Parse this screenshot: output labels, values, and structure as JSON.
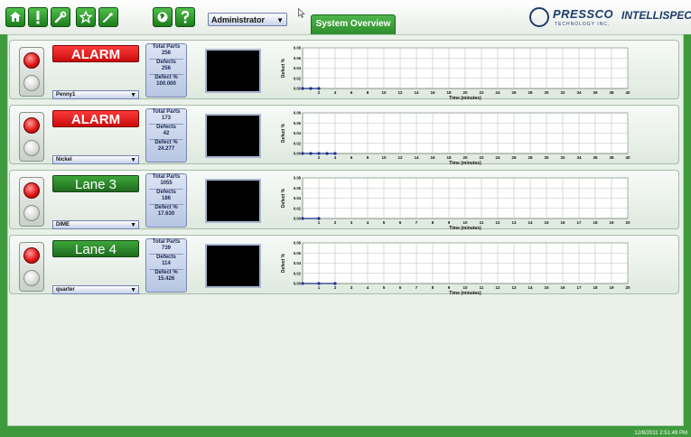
{
  "toolbar": {
    "user_select": "Administrator",
    "active_tab": "System Overview",
    "logo_pressco": "PRESSCO",
    "logo_pressco_sub": "TECHNOLOGY INC.",
    "logo_intellispec": "INTELLISPEC",
    "home_icon": "home-icon",
    "alert_icon": "exclamation-icon",
    "tools_icon": "wrench-icon",
    "favorites_icon": "star-icon",
    "wand_icon": "wand-icon",
    "globe_icon": "globe-icon",
    "help_icon": "question-icon"
  },
  "footer": {
    "datetime": "12/8/2011 2:51:49 PM"
  },
  "lanes": [
    {
      "status": "ALARM",
      "status_kind": "alarm",
      "product": "Penny1",
      "total_parts_label": "Total Parts",
      "total_parts": "256",
      "defects_label": "Defects",
      "defects": "256",
      "defect_pct_label": "Defect %",
      "defect_pct": "100.000"
    },
    {
      "status": "ALARM",
      "status_kind": "alarm",
      "product": "Nickel",
      "total_parts_label": "Total Parts",
      "total_parts": "173",
      "defects_label": "Defects",
      "defects": "42",
      "defect_pct_label": "Defect %",
      "defect_pct": "24.277"
    },
    {
      "status": "Lane 3",
      "status_kind": "ok",
      "product": "DIME",
      "total_parts_label": "Total Parts",
      "total_parts": "1055",
      "defects_label": "Defects",
      "defects": "186",
      "defect_pct_label": "Defect %",
      "defect_pct": "17.630"
    },
    {
      "status": "Lane 4",
      "status_kind": "ok",
      "product": "quarter",
      "total_parts_label": "Total Parts",
      "total_parts": "739",
      "defects_label": "Defects",
      "defects": "114",
      "defect_pct_label": "Defect %",
      "defect_pct": "15.426"
    }
  ],
  "chart_data": [
    {
      "type": "line",
      "xlabel": "Time (minutes)",
      "ylabel": "Defect %",
      "xlim": [
        0,
        40
      ],
      "ylim": [
        0,
        0.08
      ],
      "x_ticks": [
        "2",
        "4",
        "6",
        "8",
        "10",
        "12",
        "14",
        "16",
        "18",
        "20",
        "22",
        "24",
        "26",
        "28",
        "30",
        "32",
        "34",
        "36",
        "38",
        "40"
      ],
      "y_ticks": [
        "0.00",
        "0.02",
        "0.04",
        "0.06",
        "0.08"
      ],
      "grid": true,
      "series": [
        {
          "x": [
            0,
            1,
            2
          ],
          "y": [
            0,
            0,
            0
          ]
        }
      ]
    },
    {
      "type": "line",
      "xlabel": "Time (minutes)",
      "ylabel": "Defect %",
      "xlim": [
        0,
        40
      ],
      "ylim": [
        0,
        0.08
      ],
      "x_ticks": [
        "2",
        "4",
        "6",
        "8",
        "10",
        "12",
        "14",
        "16",
        "18",
        "20",
        "22",
        "24",
        "26",
        "28",
        "30",
        "32",
        "34",
        "36",
        "38",
        "40"
      ],
      "y_ticks": [
        "0.00",
        "0.02",
        "0.04",
        "0.06",
        "0.08"
      ],
      "grid": true,
      "series": [
        {
          "x": [
            0,
            1,
            2,
            3,
            4
          ],
          "y": [
            0,
            0,
            0,
            0,
            0
          ]
        }
      ]
    },
    {
      "type": "line",
      "xlabel": "Time (minutes)",
      "ylabel": "Defect %",
      "xlim": [
        0,
        20
      ],
      "ylim": [
        0,
        0.08
      ],
      "x_ticks": [
        "1",
        "2",
        "3",
        "4",
        "5",
        "6",
        "7",
        "8",
        "9",
        "10",
        "11",
        "12",
        "13",
        "14",
        "15",
        "16",
        "17",
        "18",
        "19",
        "20"
      ],
      "y_ticks": [
        "0.00",
        "0.02",
        "0.04",
        "0.06",
        "0.08"
      ],
      "grid": true,
      "series": [
        {
          "x": [
            0,
            1
          ],
          "y": [
            0,
            0
          ]
        }
      ]
    },
    {
      "type": "line",
      "xlabel": "Time (minutes)",
      "ylabel": "Defect %",
      "xlim": [
        0,
        20
      ],
      "ylim": [
        0,
        0.08
      ],
      "x_ticks": [
        "1",
        "2",
        "3",
        "4",
        "5",
        "6",
        "7",
        "8",
        "9",
        "10",
        "11",
        "12",
        "13",
        "14",
        "15",
        "16",
        "17",
        "18",
        "19",
        "20"
      ],
      "y_ticks": [
        "0.00",
        "0.02",
        "0.04",
        "0.06",
        "0.08"
      ],
      "grid": true,
      "series": [
        {
          "x": [
            0,
            1,
            2
          ],
          "y": [
            0,
            0,
            0
          ]
        }
      ]
    }
  ]
}
